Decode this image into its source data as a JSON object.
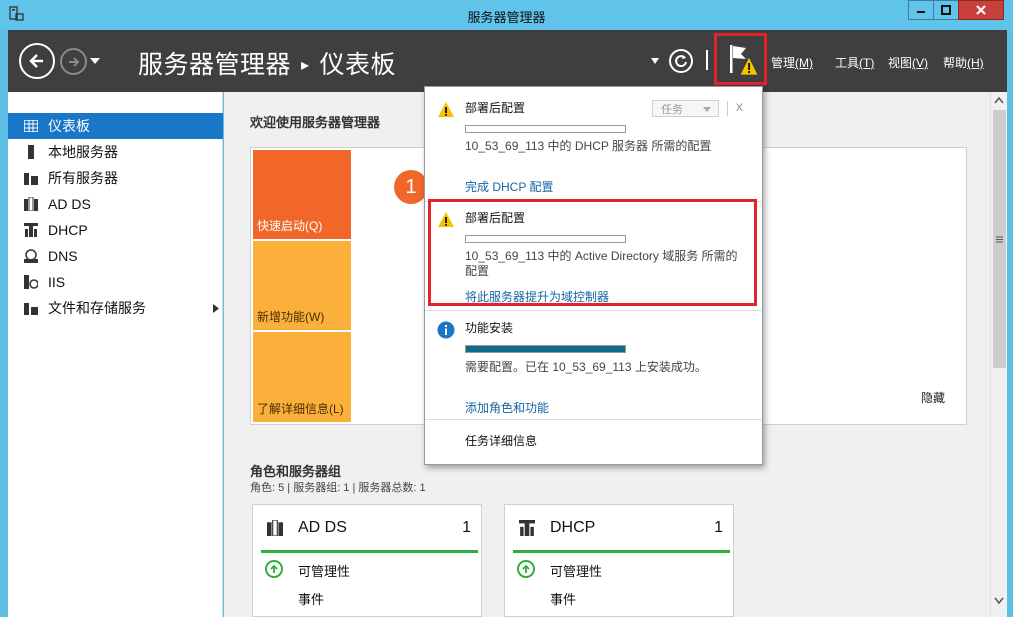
{
  "window": {
    "title": "服务器管理器"
  },
  "header": {
    "breadcrumb_root": "服务器管理器",
    "breadcrumb_sep": "▸",
    "breadcrumb_page": "仪表板",
    "menus": [
      {
        "label": "管理",
        "key": "(M)"
      },
      {
        "label": "工具",
        "key": "(T)"
      },
      {
        "label": "视图",
        "key": "(V)"
      },
      {
        "label": "帮助",
        "key": "(H)"
      }
    ]
  },
  "sidebar": {
    "items": [
      {
        "label": "仪表板",
        "icon": "dashboard-icon"
      },
      {
        "label": "本地服务器",
        "icon": "server-icon"
      },
      {
        "label": "所有服务器",
        "icon": "servers-icon"
      },
      {
        "label": "AD DS",
        "icon": "ad-ds-icon"
      },
      {
        "label": "DHCP",
        "icon": "dhcp-icon"
      },
      {
        "label": "DNS",
        "icon": "dns-icon"
      },
      {
        "label": "IIS",
        "icon": "iis-icon"
      },
      {
        "label": "文件和存储服务",
        "icon": "storage-icon"
      }
    ]
  },
  "welcome": {
    "title": "欢迎使用服务器管理器",
    "step": "1",
    "tiles": [
      "快速启动(Q)",
      "新增功能(W)",
      "了解详细信息(L)"
    ],
    "hide_label": "隐藏"
  },
  "roles": {
    "title": "角色和服务器组",
    "subtitle": "角色: 5 | 服务器组: 1 | 服务器总数: 1",
    "cards": [
      {
        "name": "AD DS",
        "count": "1",
        "manageability": "可管理性",
        "events": "事件"
      },
      {
        "name": "DHCP",
        "count": "1",
        "manageability": "可管理性",
        "events": "事件"
      }
    ]
  },
  "notifications": {
    "task_button": "任务",
    "close": "x",
    "items": [
      {
        "title": "部署后配置",
        "desc": "10_53_69_113 中的 DHCP 服务器 所需的配置",
        "link": "完成 DHCP 配置",
        "progress": 0
      },
      {
        "title": "部署后配置",
        "desc": "10_53_69_113 中的 Active Directory 域服务 所需的配置",
        "link": "将此服务器提升为域控制器",
        "progress": 0
      },
      {
        "title": "功能安装",
        "desc": "需要配置。已在 10_53_69_113 上安装成功。",
        "link": "添加角色和功能",
        "progress": 1.0
      }
    ],
    "task_details": "任务详细信息"
  },
  "colors": {
    "accent": "#1a76c6",
    "orange": "#f1672a",
    "amber": "#fbb03c",
    "highlight_red": "#e3242b",
    "success_green": "#2eae3a",
    "progress_teal": "#0f6b8a",
    "link_blue": "#1464a5"
  }
}
